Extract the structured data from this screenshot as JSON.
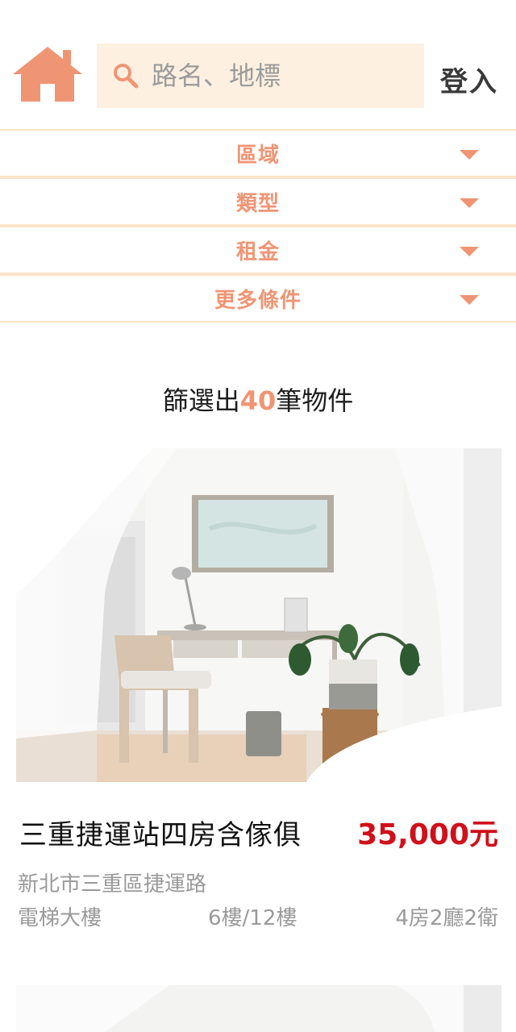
{
  "header": {
    "logo_icon": "home-icon",
    "search": {
      "placeholder": "路名、地標",
      "icon": "search-icon"
    },
    "login_label": "登入"
  },
  "filters": [
    {
      "label": "區域"
    },
    {
      "label": "類型"
    },
    {
      "label": "租金"
    },
    {
      "label": "更多條件"
    }
  ],
  "results": {
    "prefix": "篩選出",
    "count": "40",
    "suffix": "筆物件"
  },
  "listings": [
    {
      "title": "三重捷運站四房含傢俱",
      "price": "35,000元",
      "address": "新北市三重區捷運路",
      "building_type": "電梯大樓",
      "floor": "6樓/12樓",
      "rooms": "4房2廳2衛"
    }
  ],
  "colors": {
    "accent": "#ef9574",
    "search_bg": "#fdf0e0",
    "price": "#d0101b",
    "divider": "#fbe3c8"
  }
}
